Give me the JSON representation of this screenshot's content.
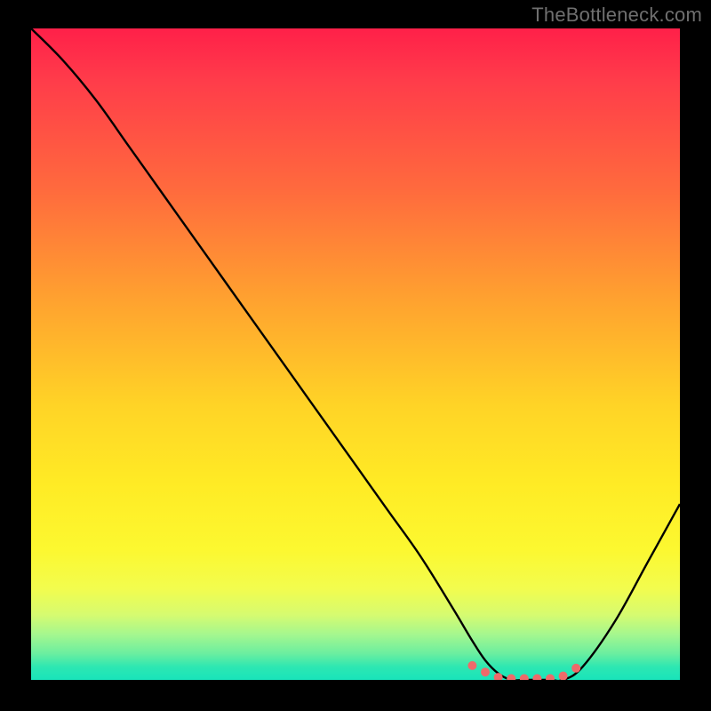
{
  "watermark": "TheBottleneck.com",
  "chart_data": {
    "type": "line",
    "title": "",
    "xlabel": "",
    "ylabel": "",
    "xlim": [
      0,
      100
    ],
    "ylim": [
      0,
      100
    ],
    "x": [
      0,
      5,
      10,
      15,
      20,
      25,
      30,
      35,
      40,
      45,
      50,
      55,
      60,
      65,
      68,
      70,
      72,
      74,
      76,
      78,
      80,
      82,
      85,
      90,
      95,
      100
    ],
    "y": [
      100,
      95,
      89,
      82,
      75,
      68,
      61,
      54,
      47,
      40,
      33,
      26,
      19,
      11,
      6,
      3,
      1,
      0,
      0,
      0,
      0,
      0,
      2,
      9,
      18,
      27
    ],
    "flat_region": {
      "x_start": 72,
      "x_end": 82,
      "y": 0
    },
    "markers": {
      "type": "dotted-band",
      "color": "#ee6a6a",
      "points": [
        {
          "x": 68,
          "y": 2.2
        },
        {
          "x": 70,
          "y": 1.2
        },
        {
          "x": 72,
          "y": 0.4
        },
        {
          "x": 74,
          "y": 0.2
        },
        {
          "x": 76,
          "y": 0.2
        },
        {
          "x": 78,
          "y": 0.2
        },
        {
          "x": 80,
          "y": 0.2
        },
        {
          "x": 82,
          "y": 0.6
        },
        {
          "x": 84,
          "y": 1.8
        }
      ]
    },
    "background_gradient": {
      "top_color": "#ff2049",
      "mid_color": "#ffeb25",
      "bottom_color": "#19e4ba"
    }
  }
}
